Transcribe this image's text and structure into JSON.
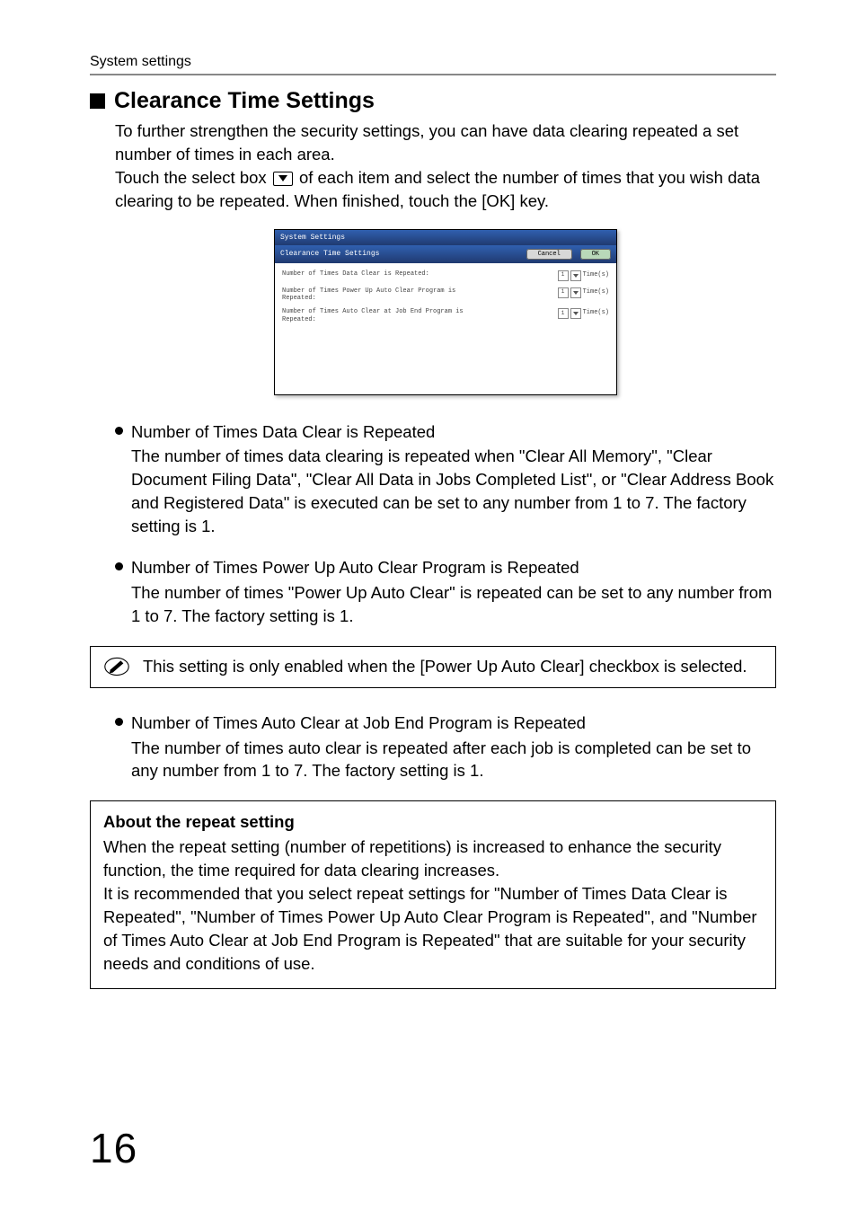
{
  "header": {
    "section": "System settings"
  },
  "title": "Clearance Time Settings",
  "intro": {
    "p1": "To further strengthen the security settings, you can have data clearing repeated a set number of times in each area.",
    "p2_a": "Touch the select box ",
    "p2_b": " of each item and select the number of times that you wish data clearing to be repeated. When finished, touch the [OK] key."
  },
  "screenshot": {
    "title": "System Settings",
    "subtitle": "Clearance Time Settings",
    "cancel": "Cancel",
    "ok": "OK",
    "rows": [
      {
        "label": "Number of Times Data Clear is Repeated:",
        "value": "1",
        "suffix": "Time(s)"
      },
      {
        "label": "Number of Times Power Up Auto Clear Program is Repeated:",
        "value": "1",
        "suffix": "Time(s)"
      },
      {
        "label": "Number of Times Auto Clear at Job End Program is Repeated:",
        "value": "1",
        "suffix": "Time(s)"
      }
    ]
  },
  "bullets": [
    {
      "head": "Number of Times Data Clear is Repeated",
      "body": "The number of times data clearing is repeated when \"Clear All Memory\", \"Clear Document Filing Data\", \"Clear All Data in Jobs Completed List\", or \"Clear Address Book and Registered Data\" is executed can be set to any number from 1 to 7. The factory setting is 1."
    },
    {
      "head": "Number of Times Power Up Auto Clear Program is Repeated",
      "body": "The number of times \"Power Up Auto Clear\" is repeated can be set to any number from 1 to 7. The factory setting is 1."
    }
  ],
  "note": "This setting is only enabled when the [Power Up Auto Clear] checkbox is selected.",
  "bullet3": {
    "head": "Number of Times Auto Clear at Job End Program is Repeated",
    "body": "The number of times auto clear is repeated after each job is completed can be set to any number from 1 to 7. The factory setting is 1."
  },
  "about": {
    "title": "About the repeat setting",
    "p1": "When the repeat setting (number of repetitions) is increased to enhance the security function, the time required for data clearing increases.",
    "p2": "It is recommended that you select repeat settings for \"Number of Times Data Clear is Repeated\", \"Number of Times Power Up Auto Clear Program is Repeated\", and \"Number of Times Auto Clear at Job End Program is Repeated\" that are suitable for your security needs and conditions of use."
  },
  "pagenum": "16"
}
